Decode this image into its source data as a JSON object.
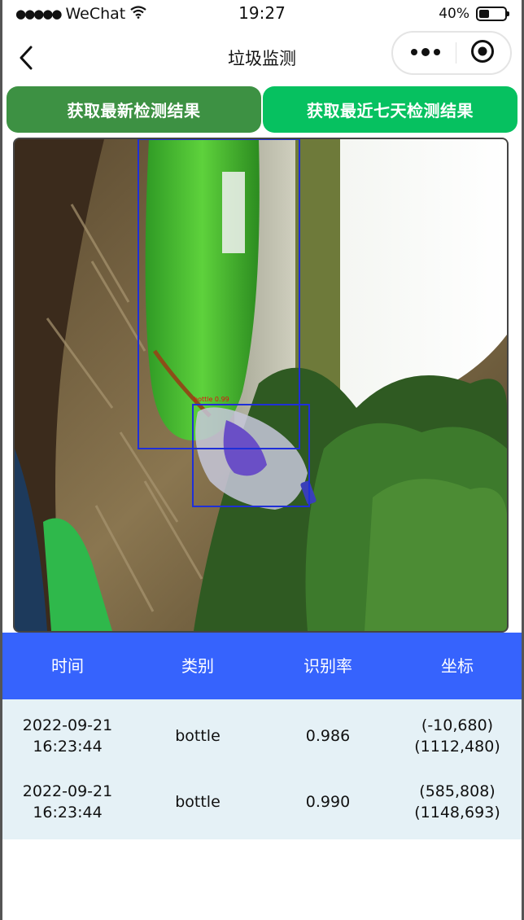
{
  "status_bar": {
    "signal": "●●●●●",
    "carrier": "WeChat",
    "time": "19:27",
    "battery_text": "40%",
    "battery_level": 0.4
  },
  "nav": {
    "title": "垃圾监测"
  },
  "actions": {
    "latest_label": "获取最新检测结果",
    "week_label": "获取最近七天检测结果"
  },
  "detection_image": {
    "label": "bottle 0.99"
  },
  "table": {
    "headers": [
      "时间",
      "类别",
      "识别率",
      "坐标"
    ],
    "rows": [
      {
        "date": "2022-09-21",
        "time": "16:23:44",
        "category": "bottle",
        "rate": "0.986",
        "coord_a": "(-10,680)",
        "coord_b": "(1112,480)"
      },
      {
        "date": "2022-09-21",
        "time": "16:23:44",
        "category": "bottle",
        "rate": "0.990",
        "coord_a": "(585,808)",
        "coord_b": "(1148,693)"
      }
    ]
  },
  "colors": {
    "latest_button": "#3d9143",
    "week_button": "#06c160",
    "table_header": "#3663fd",
    "table_body": "#e5f1f6"
  }
}
